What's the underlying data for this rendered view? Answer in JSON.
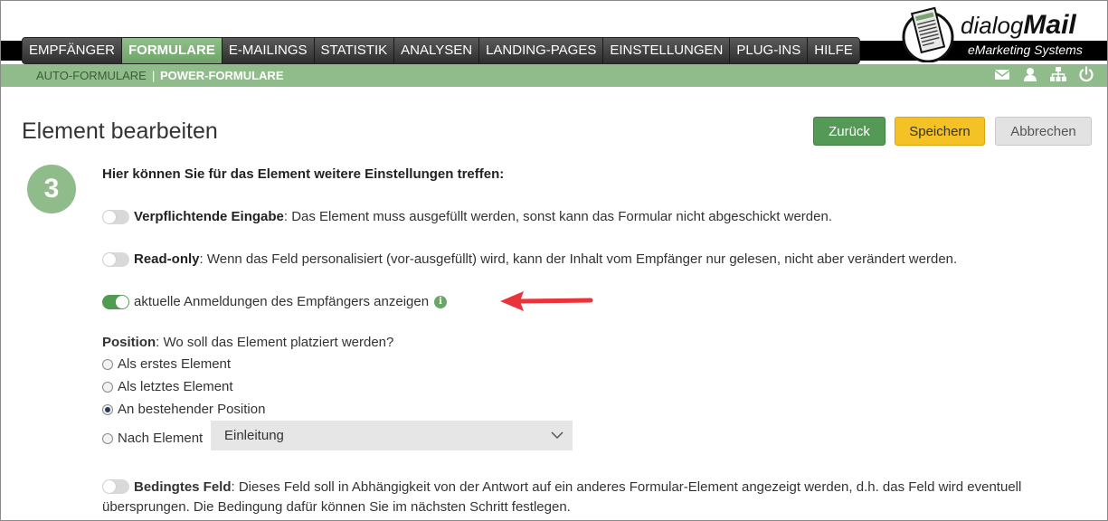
{
  "nav": {
    "items": [
      "EMPFÄNGER",
      "FORMULARE",
      "E-MAILINGS",
      "STATISTIK",
      "ANALYSEN",
      "LANDING-PAGES",
      "EINSTELLUNGEN",
      "PLUG-INS",
      "HILFE"
    ],
    "active": "FORMULARE"
  },
  "logo": {
    "prefix": "dialog",
    "brand": "Mail",
    "tagline": "eMarketing Systems"
  },
  "subnav": {
    "auto": "AUTO-FORMULARE",
    "separator": "|",
    "power": "POWER-FORMULARE"
  },
  "utility_icons": [
    "envelope-icon",
    "user-icon",
    "sitemap-icon",
    "power-icon"
  ],
  "page": {
    "title": "Element bearbeiten",
    "back_label": "Zurück",
    "save_label": "Speichern",
    "cancel_label": "Abbrechen",
    "step_number": "3",
    "heading": "Hier können Sie für das Element weitere Einstellungen treffen:"
  },
  "options": {
    "mandatory": {
      "label": "Verpflichtende Eingabe",
      "text": ": Das Element muss ausgefüllt werden, sonst kann das Formular nicht abgeschickt werden.",
      "on": false
    },
    "readonly": {
      "label": "Read-only",
      "text": ": Wenn das Feld personalisiert (vor-ausgefüllt) wird, kann der Inhalt vom Empfänger nur gelesen, nicht aber verändert werden.",
      "on": false
    },
    "registrations": {
      "text": "aktuelle Anmeldungen des Empfängers anzeigen",
      "on": true,
      "info_glyph": "i"
    }
  },
  "position": {
    "label": "Position",
    "question": ": Wo soll das Element platziert werden?",
    "options": [
      "Als erstes Element",
      "Als letztes Element",
      "An bestehender Position",
      "Nach Element"
    ],
    "selected": "An bestehender Position",
    "after_element_value": "Einleitung"
  },
  "conditional": {
    "label": "Bedingtes Feld",
    "text": ": Dieses Feld soll in Abhängigkeit von der Antwort auf ein anderes Formular-Element angezeigt werden, d.h. das Feld wird eventuell übersprungen. Die Bedingung dafür können Sie im nächsten Schritt festlegen.",
    "on": false
  },
  "colors": {
    "green": "#8fbc8a",
    "button_green": "#559957",
    "button_yellow": "#f4c224",
    "arrow_red": "#e8343a"
  }
}
